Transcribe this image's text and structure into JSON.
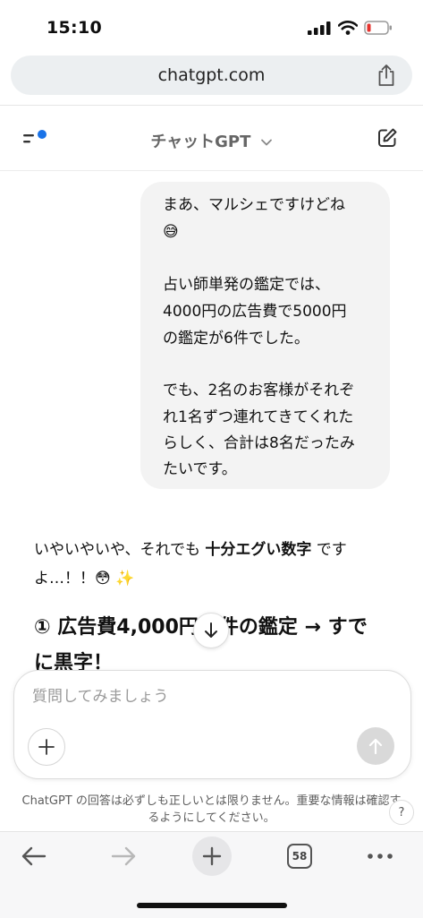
{
  "status_bar": {
    "time": "15:10"
  },
  "browser": {
    "url": "chatgpt.com",
    "tab_count": "58"
  },
  "header": {
    "model_title": "チャットGPT"
  },
  "user_message": {
    "lines": [
      "まあ、マルシェですけどね",
      "😅",
      "",
      "占い師単発の鑑定では、",
      "4000円の広告費で5000円",
      "の鑑定が6件でした。",
      "",
      "でも、2名のお客様がそれぞ",
      "れ1名ずつ連れてきてくれた",
      "らしく、合計は8名だったみ",
      "たいです。"
    ]
  },
  "assistant_message": {
    "line1_prefix": "いやいやいや、それでも ",
    "line1_bold": "十分エグい数字",
    "line1_suffix": " です",
    "line2": "よ…！！😳 ✨",
    "heading_line1": "① 広告費4,000円  6件の鑑定 → すで",
    "heading_line2": "に黒字！"
  },
  "composer": {
    "placeholder": "質問してみましょう"
  },
  "disclaimer": {
    "line1": "ChatGPT の回答は必ずしも正しいとは限りません。重要な情報は確認す",
    "line2": "るようにしてください。"
  },
  "help_label": "?",
  "colors": {
    "accent_dot": "#1a73e8",
    "send_disabled": "#d9d9d9",
    "bubble_bg": "#f3f3f3"
  },
  "icons": [
    "signal-icon",
    "wifi-icon",
    "battery-icon",
    "share-icon",
    "menu-icon",
    "chevron-down-icon",
    "edit-icon",
    "arrow-down-icon",
    "plus-icon",
    "arrow-up-icon",
    "back-icon",
    "forward-icon",
    "tabs-icon",
    "more-icon"
  ]
}
